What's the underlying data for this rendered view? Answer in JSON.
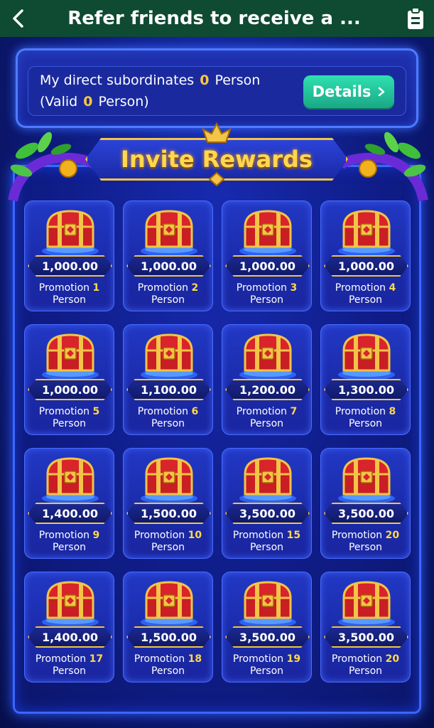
{
  "header": {
    "title": "Refer friends to receive a ...",
    "back_icon": "chevron-left-icon",
    "right_icon": "clipboard-icon"
  },
  "summary": {
    "line1_label": "My direct subordinates",
    "line1_count": "0",
    "line1_unit": "Person",
    "line2_label": "(Valid",
    "line2_count": "0",
    "line2_unit": "Person)",
    "details_label": "Details",
    "details_icon": "chevron-right-icon"
  },
  "banner": {
    "title": "Invite Rewards"
  },
  "colors": {
    "accent_gold": "#ffd84d",
    "header_green": "#0f4a33",
    "button_teal": "#2fe0b0"
  },
  "rewards": [
    {
      "amount": "1,000.00",
      "label": "Promotion",
      "count": "1",
      "unit": "Person"
    },
    {
      "amount": "1,000.00",
      "label": "Promotion",
      "count": "2",
      "unit": "Person"
    },
    {
      "amount": "1,000.00",
      "label": "Promotion",
      "count": "3",
      "unit": "Person"
    },
    {
      "amount": "1,000.00",
      "label": "Promotion",
      "count": "4",
      "unit": "Person"
    },
    {
      "amount": "1,000.00",
      "label": "Promotion",
      "count": "5",
      "unit": "Person"
    },
    {
      "amount": "1,100.00",
      "label": "Promotion",
      "count": "6",
      "unit": "Person"
    },
    {
      "amount": "1,200.00",
      "label": "Promotion",
      "count": "7",
      "unit": "Person"
    },
    {
      "amount": "1,300.00",
      "label": "Promotion",
      "count": "8",
      "unit": "Person"
    },
    {
      "amount": "1,400.00",
      "label": "Promotion",
      "count": "9",
      "unit": "Person"
    },
    {
      "amount": "1,500.00",
      "label": "Promotion",
      "count": "10",
      "unit": "Person"
    },
    {
      "amount": "3,500.00",
      "label": "Promotion",
      "count": "15",
      "unit": "Person"
    },
    {
      "amount": "3,500.00",
      "label": "Promotion",
      "count": "20",
      "unit": "Person"
    },
    {
      "amount": "1,400.00",
      "label": "Promotion",
      "count": "17",
      "unit": "Person"
    },
    {
      "amount": "1,500.00",
      "label": "Promotion",
      "count": "18",
      "unit": "Person"
    },
    {
      "amount": "3,500.00",
      "label": "Promotion",
      "count": "19",
      "unit": "Person"
    },
    {
      "amount": "3,500.00",
      "label": "Promotion",
      "count": "20",
      "unit": "Person"
    }
  ]
}
